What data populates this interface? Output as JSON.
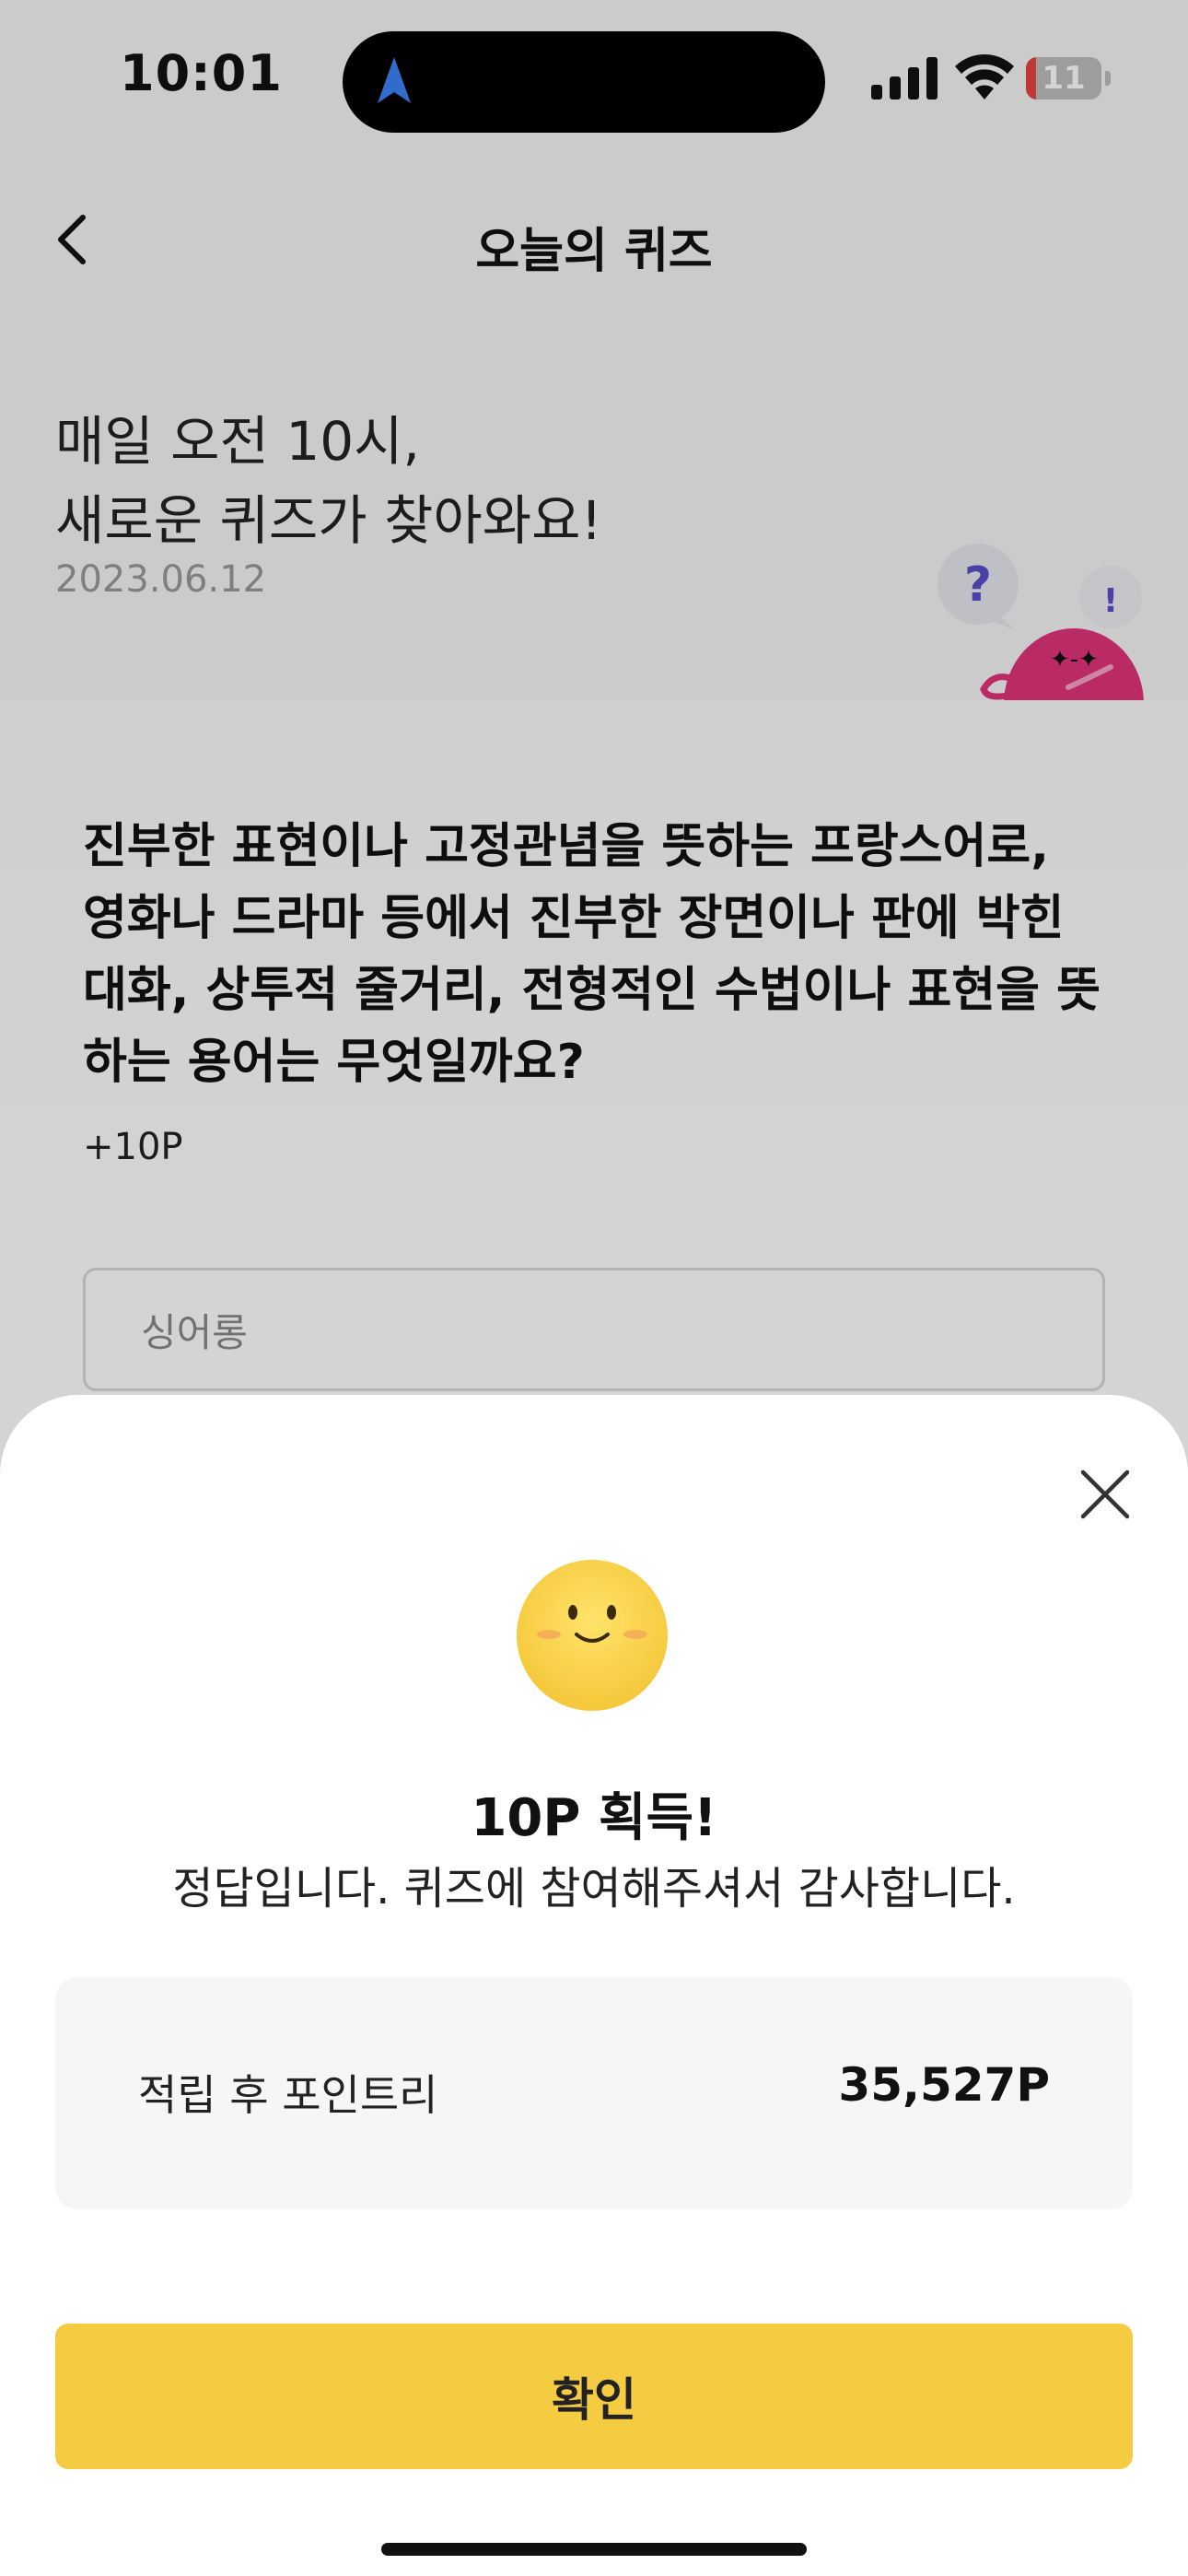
{
  "status_bar": {
    "time": "10:01",
    "battery": "11",
    "battery_level": 0.11,
    "icons": [
      "navigation-arrow-icon",
      "cellular-signal-icon",
      "wifi-icon",
      "battery-icon"
    ]
  },
  "header": {
    "title": "오늘의 퀴즈",
    "back_icon": "chevron-left-icon"
  },
  "intro": {
    "title": "매일 오전 10시,\n새로운 퀴즈가 찾아와요!",
    "date": "2023.06.12",
    "mascot_marks": [
      "?",
      "!"
    ]
  },
  "quiz": {
    "question": "진부한 표현이나 고정관념을 뜻하는 프랑스어로, 영화나 드라마 등에서 진부한 장면이나 판에 박힌 대화, 상투적 줄거리, 전형적인 수법이나 표현을 뜻하는 용어는 무엇일까요?",
    "points": "+10P",
    "answer_value": "싱어롱"
  },
  "result_sheet": {
    "close_icon": "close-icon",
    "emoji": "smiley-face-icon",
    "title": "10P 획득!",
    "message": "정답입니다. 퀴즈에 참여해주셔서 감사합니다.",
    "points_label": "적립 후 포인트리",
    "points_value": "35,527P",
    "confirm_label": "확인"
  },
  "colors": {
    "accent_yellow": "#f5cb42",
    "mascot_pink": "#e0337a",
    "question_purple": "#5b4ec9",
    "battery_red": "#e5453f",
    "nav_arrow_blue": "#3b82f6"
  }
}
